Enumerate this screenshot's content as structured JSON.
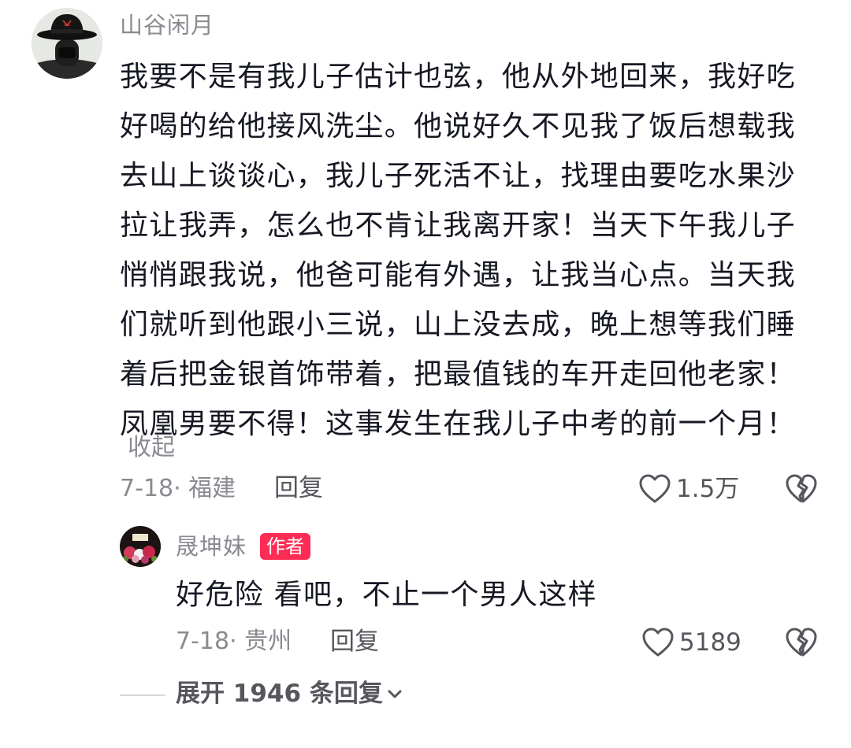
{
  "comment": {
    "username": "山谷闲月",
    "text": "我要不是有我儿子估计也弦，他从外地回来，我好吃好喝的给他接风洗尘。他说好久不见我了饭后想载我去山上谈谈心，我儿子死活不让，找理由要吃水果沙拉让我弄，怎么也不肯让我离开家！当天下午我儿子悄悄跟我说，他爸可能有外遇，让我当心点。当天我们就听到他跟小三说，山上没去成，晚上想等我们睡着后把金银首饰带着，把最值钱的车开走回他老家！凤凰男要不得！这事发生在我儿子中考的前一个月！",
    "collapse_label": "收起",
    "date_location": "7-18· 福建",
    "reply_label": "回复",
    "like_count": "1.5万",
    "avatar_icon": "user-avatar-hat-mask"
  },
  "reply": {
    "username": "晟坤妹",
    "badge": "作者",
    "text": "好危险 看吧，不止一个男人这样",
    "date_location": "7-18· 贵州",
    "reply_label": "回复",
    "like_count": "5189",
    "avatar_icon": "author-avatar-flowers"
  },
  "expand": {
    "label": "展开 1946 条回复"
  },
  "colors": {
    "badge": "#fe2c55",
    "text_primary": "#161823",
    "text_secondary": "#8a8b91",
    "text_action": "#56575d"
  }
}
